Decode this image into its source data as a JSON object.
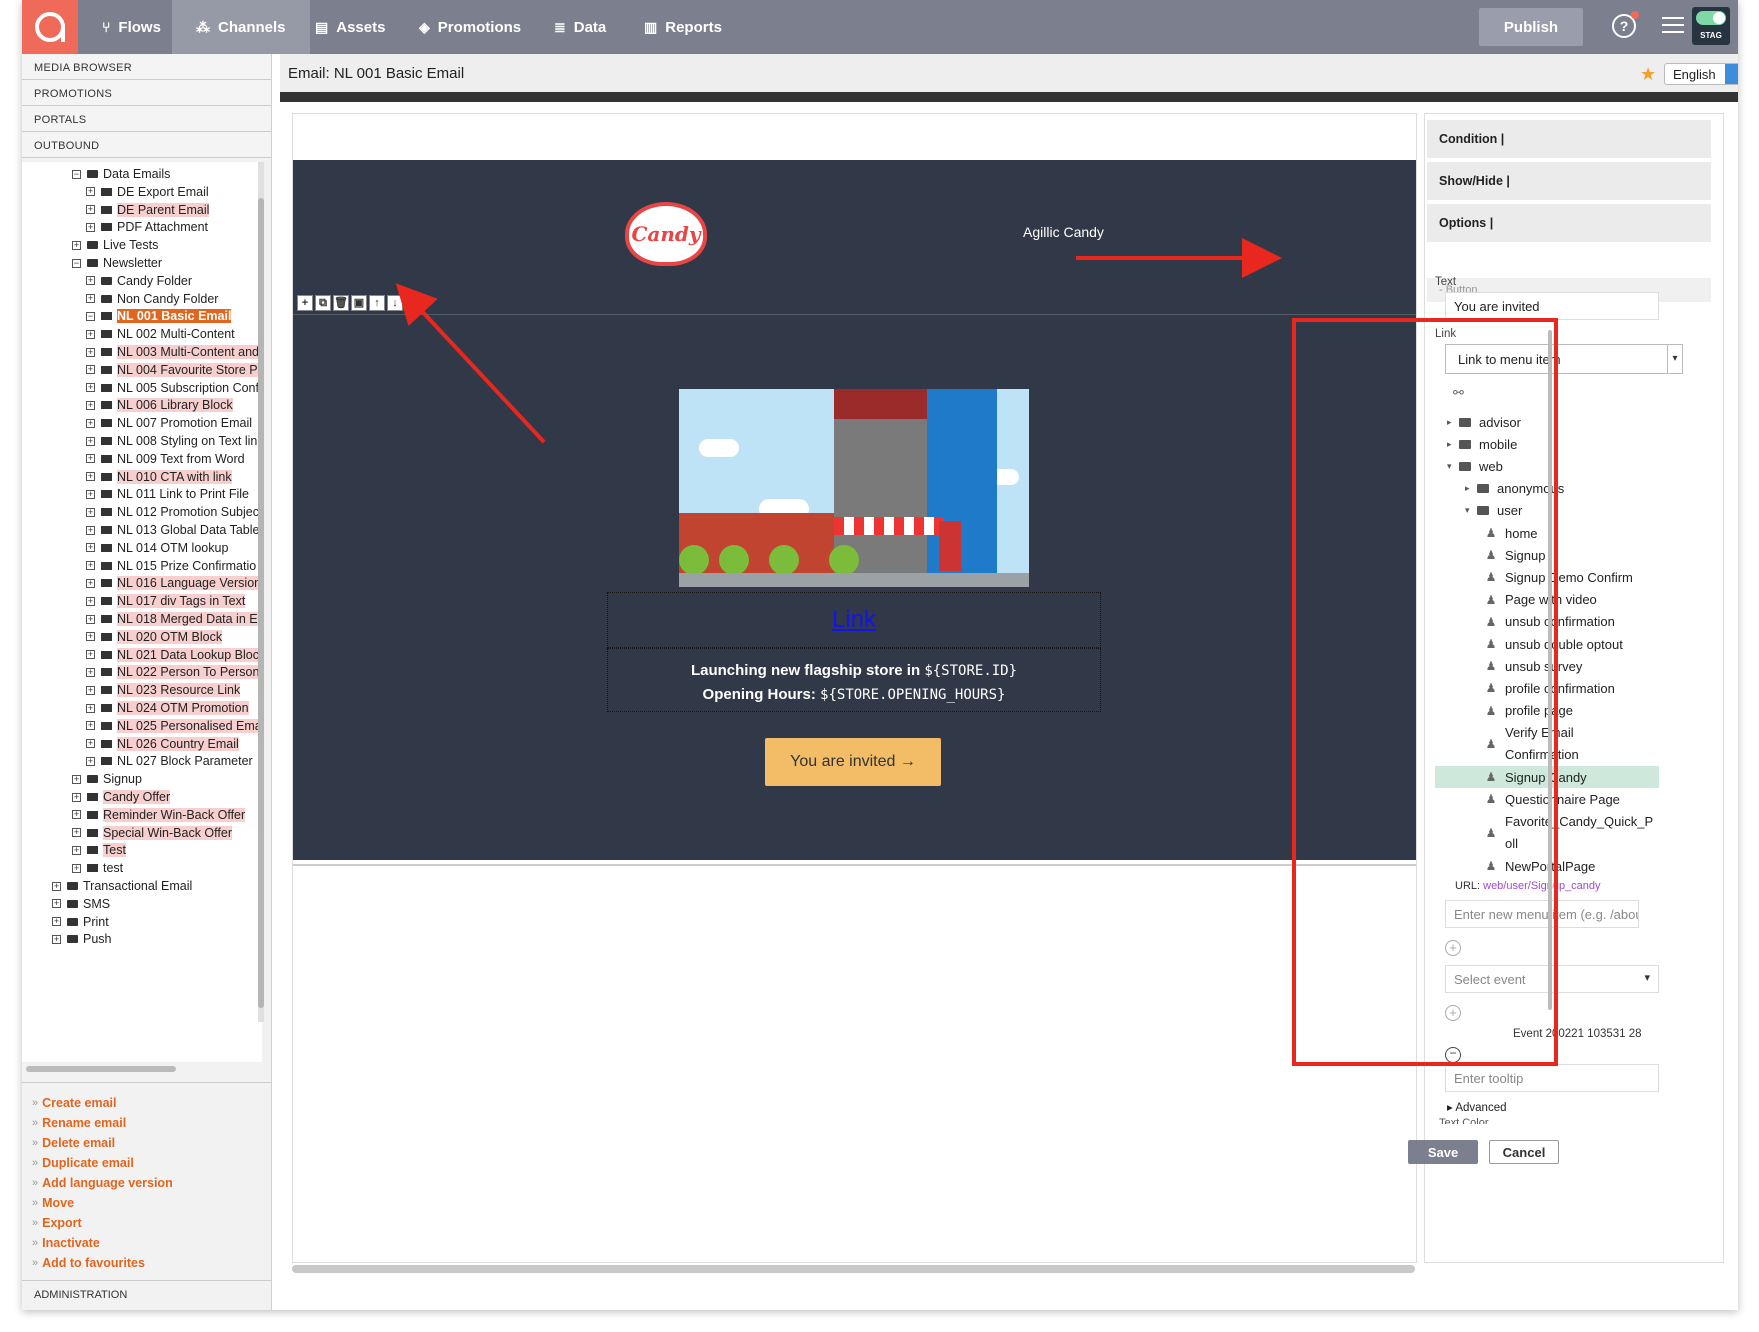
{
  "nav": {
    "items": [
      {
        "label": "Flows",
        "icon": "flows-icon"
      },
      {
        "label": "Channels",
        "icon": "channels-icon"
      },
      {
        "label": "Assets",
        "icon": "assets-icon"
      },
      {
        "label": "Promotions",
        "icon": "promotions-icon"
      },
      {
        "label": "Data",
        "icon": "data-icon"
      },
      {
        "label": "Reports",
        "icon": "reports-icon"
      }
    ],
    "active": "Channels",
    "publish_label": "Publish",
    "help": "?",
    "env_badge": "STAG"
  },
  "sidebar": {
    "sections": [
      "MEDIA BROWSER",
      "PROMOTIONS",
      "PORTALS",
      "OUTBOUND"
    ],
    "tree": [
      {
        "label": "Data Emails",
        "type": "folder",
        "level": 1,
        "open": true,
        "hl": ""
      },
      {
        "label": "DE Export Email",
        "type": "email",
        "level": 2,
        "hl": ""
      },
      {
        "label": "DE Parent Email",
        "type": "email",
        "level": 2,
        "hl": "pink"
      },
      {
        "label": "PDF Attachment",
        "type": "email",
        "level": 2,
        "hl": ""
      },
      {
        "label": "Live Tests",
        "type": "folder",
        "level": 1,
        "open": false,
        "hl": ""
      },
      {
        "label": "Newsletter",
        "type": "folder",
        "level": 1,
        "open": true,
        "hl": ""
      },
      {
        "label": "Candy Folder",
        "type": "folder",
        "level": 2,
        "hl": ""
      },
      {
        "label": "Non Candy Folder",
        "type": "folder",
        "level": 2,
        "hl": ""
      },
      {
        "label": "NL 001 Basic Email",
        "type": "email",
        "level": 2,
        "open": true,
        "hl": "sel"
      },
      {
        "label": "NL 002 Multi-Content",
        "type": "email",
        "level": 2,
        "hl": ""
      },
      {
        "label": "NL 003 Multi-Content and",
        "type": "email",
        "level": 2,
        "hl": "pink"
      },
      {
        "label": "NL 004 Favourite Store P",
        "type": "email",
        "level": 2,
        "hl": "pink"
      },
      {
        "label": "NL 005 Subscription Conf",
        "type": "email",
        "level": 2,
        "hl": ""
      },
      {
        "label": "NL 006 Library Block",
        "type": "email",
        "level": 2,
        "hl": "pink"
      },
      {
        "label": "NL 007 Promotion Email",
        "type": "email",
        "level": 2,
        "hl": ""
      },
      {
        "label": "NL 008 Styling on Text lin",
        "type": "email",
        "level": 2,
        "hl": ""
      },
      {
        "label": "NL 009 Text from Word",
        "type": "email",
        "level": 2,
        "hl": ""
      },
      {
        "label": "NL 010 CTA with link",
        "type": "email",
        "level": 2,
        "hl": "pink"
      },
      {
        "label": "NL 011 Link to Print File",
        "type": "email",
        "level": 2,
        "hl": ""
      },
      {
        "label": "NL 012 Promotion Subjec",
        "type": "email",
        "level": 2,
        "hl": ""
      },
      {
        "label": "NL 013 Global Data Table",
        "type": "email",
        "level": 2,
        "hl": ""
      },
      {
        "label": "NL 014 OTM lookup",
        "type": "email",
        "level": 2,
        "hl": ""
      },
      {
        "label": "NL 015 Prize Confirmatio",
        "type": "email",
        "level": 2,
        "hl": ""
      },
      {
        "label": "NL 016 Language Version",
        "type": "email",
        "level": 2,
        "hl": "pink"
      },
      {
        "label": "NL 017 div Tags in Text",
        "type": "email",
        "level": 2,
        "hl": "pink"
      },
      {
        "label": "NL 018 Merged Data in Er",
        "type": "email",
        "level": 2,
        "hl": "pink"
      },
      {
        "label": "NL 020 OTM Block",
        "type": "email",
        "level": 2,
        "hl": "pink"
      },
      {
        "label": "NL 021 Data Lookup Bloc",
        "type": "email",
        "level": 2,
        "hl": "pink"
      },
      {
        "label": "NL 022 Person To Person",
        "type": "email",
        "level": 2,
        "hl": "pink"
      },
      {
        "label": "NL 023 Resource Link",
        "type": "email",
        "level": 2,
        "hl": "pink"
      },
      {
        "label": "NL 024 OTM Promotion",
        "type": "email",
        "level": 2,
        "hl": "pink"
      },
      {
        "label": "NL 025 Personalised Ema",
        "type": "email",
        "level": 2,
        "hl": "pink"
      },
      {
        "label": "NL 026 Country Email",
        "type": "email",
        "level": 2,
        "hl": "pink"
      },
      {
        "label": "NL 027 Block Parameter",
        "type": "email",
        "level": 2,
        "hl": ""
      },
      {
        "label": "Signup",
        "type": "folder",
        "level": 1,
        "hl": ""
      },
      {
        "label": "Candy Offer",
        "type": "email",
        "level": 1,
        "hl": "pink"
      },
      {
        "label": "Reminder Win-Back Offer",
        "type": "email",
        "level": 1,
        "hl": "pink"
      },
      {
        "label": "Special Win-Back Offer",
        "type": "email",
        "level": 1,
        "hl": "pink"
      },
      {
        "label": "Test",
        "type": "email",
        "level": 1,
        "hl": "pink"
      },
      {
        "label": "test",
        "type": "email",
        "level": 1,
        "hl": ""
      },
      {
        "label": "Transactional Email",
        "type": "folder",
        "level": 0,
        "hl": ""
      },
      {
        "label": "SMS",
        "type": "folder",
        "level": 0,
        "hl": ""
      },
      {
        "label": "Print",
        "type": "folder",
        "level": 0,
        "hl": ""
      },
      {
        "label": "Push",
        "type": "folder",
        "level": 0,
        "hl": ""
      }
    ],
    "actions": [
      "Create email",
      "Rename email",
      "Delete email",
      "Duplicate email",
      "Add language version",
      "Move",
      "Export",
      "Inactivate",
      "Add to favourites"
    ],
    "admin": "ADMINISTRATION"
  },
  "main": {
    "title": "Email: NL 001 Basic Email",
    "language": "English",
    "email": {
      "brand": "Agillic Candy",
      "logo_text": "Candy",
      "link_text": "Link",
      "line1_text": "Launching new flagship store in ",
      "line1_var": "${STORE.ID}",
      "line2_text": "Opening Hours: ",
      "line2_var": "${STORE.OPENING_HOURS}",
      "cta_label": "You are invited →"
    },
    "toolbar_icons": [
      "add-block-icon",
      "copy-block-icon",
      "delete-block-icon",
      "save-block-icon",
      "move-up-icon",
      "move-down-icon",
      "info-icon"
    ]
  },
  "panel": {
    "accordions": [
      "Condition |",
      "Show/Hide |",
      "Options |"
    ],
    "button_section": "- Button",
    "text_label": "Text",
    "text_value": "You are invited",
    "link_label": "Link",
    "link_select": "Link to menu item",
    "menu": [
      {
        "label": "advisor",
        "type": "folder",
        "level": 0,
        "state": "closed"
      },
      {
        "label": "mobile",
        "type": "folder",
        "level": 0,
        "state": "closed"
      },
      {
        "label": "web",
        "type": "folder",
        "level": 0,
        "state": "open"
      },
      {
        "label": "anonymous",
        "type": "folder",
        "level": 1,
        "state": "closed"
      },
      {
        "label": "user",
        "type": "folder",
        "level": 1,
        "state": "open"
      },
      {
        "label": "home",
        "type": "page",
        "level": 2
      },
      {
        "label": "Signup",
        "type": "page",
        "level": 2
      },
      {
        "label": "Signup Demo Confirm",
        "type": "page",
        "level": 2
      },
      {
        "label": "Page with video",
        "type": "page",
        "level": 2
      },
      {
        "label": "unsub confirmation",
        "type": "page",
        "level": 2
      },
      {
        "label": "unsub double optout",
        "type": "page",
        "level": 2
      },
      {
        "label": "unsub survey",
        "type": "page",
        "level": 2
      },
      {
        "label": "profile confirmation",
        "type": "page",
        "level": 2
      },
      {
        "label": "profile page",
        "type": "page",
        "level": 2
      },
      {
        "label": "Verify Email",
        "label2": "Confirmation",
        "type": "page",
        "level": 2
      },
      {
        "label": "Signup Candy",
        "type": "page",
        "level": 2,
        "selected": true
      },
      {
        "label": "Questionnaire Page",
        "type": "page",
        "level": 2
      },
      {
        "label": "Favorite_Candy_Quick_P",
        "label2": "oll",
        "type": "page",
        "level": 2
      },
      {
        "label": "NewPortalPage",
        "type": "page",
        "level": 2
      }
    ],
    "url_label": "URL: ",
    "url_value": "web/user/Signup_candy",
    "new_menu_placeholder": "Enter new menu item (e.g. /about)",
    "event_placeholder": "Select event",
    "event_text": "Event 200221 103531 28",
    "tooltip_placeholder": "Enter tooltip",
    "advanced": "Advanced",
    "text_color_label": "Text Color",
    "save_label": "Save",
    "cancel_label": "Cancel"
  },
  "colors": {
    "accent": "#e2651e",
    "annotation": "#e8281e",
    "email_bg": "#313848",
    "cta": "#f3bc67",
    "nav_bg": "#7b7f8e"
  }
}
